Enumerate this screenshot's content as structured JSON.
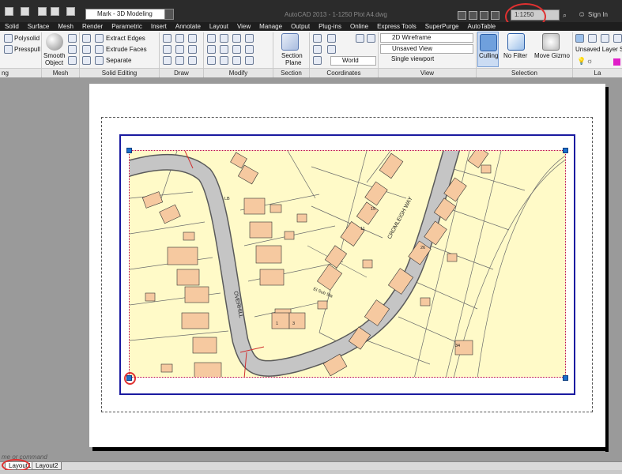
{
  "window": {
    "workspace": "Mark - 3D Modeling",
    "app_title": "AutoCAD 2013 - 1-1250 Plot A4.dwg",
    "scale": "1:1250",
    "sign_in": "Sign In"
  },
  "menu": [
    "Solid",
    "Surface",
    "Mesh",
    "Render",
    "Parametric",
    "Insert",
    "Annotate",
    "Layout",
    "View",
    "Manage",
    "Output",
    "Plug-ins",
    "Online",
    "Express Tools",
    "SuperPurge",
    "AutoTable"
  ],
  "ribbon": {
    "polysolid": "Polysolid",
    "presspull": "Presspull",
    "smooth_object": [
      "Smooth",
      "Object"
    ],
    "extract_edges": "Extract Edges",
    "extrude_faces": "Extrude Faces",
    "separate": "Separate",
    "section_plane": [
      "Section",
      "Plane"
    ],
    "visual_style": "2D Wireframe",
    "named_view": "Unsaved View",
    "ucs": "World",
    "viewport": "Single viewport",
    "culling": "Culling",
    "no_filter": "No Filter",
    "move_gizmo": "Move Gizmo",
    "layer_state": "Unsaved Layer Stat",
    "panels": {
      "modeling": "ng",
      "mesh": "Mesh",
      "solid_editing": "Solid Editing",
      "draw": "Draw",
      "modify": "Modify",
      "section": "Section",
      "coordinates": "Coordinates",
      "view": "View",
      "selection": "Selection",
      "layers": "La"
    }
  },
  "map": {
    "street1": "OVERHILL",
    "street2": "CROMLEIGH WAY",
    "building_label": "El Sub Sta",
    "house_numbers": [
      "1",
      "3",
      "11",
      "15",
      "26",
      "34",
      "LB"
    ]
  },
  "command": "me or command",
  "tabs": [
    "Layout1",
    "Layout2"
  ],
  "colors": {
    "viewport_border": "#1a1aa0",
    "grip": "#1b6fcc",
    "highlight": "#e03030",
    "map_fill": "#fffac8",
    "building": "#f6c9a0",
    "road": "#bfbfbf"
  }
}
